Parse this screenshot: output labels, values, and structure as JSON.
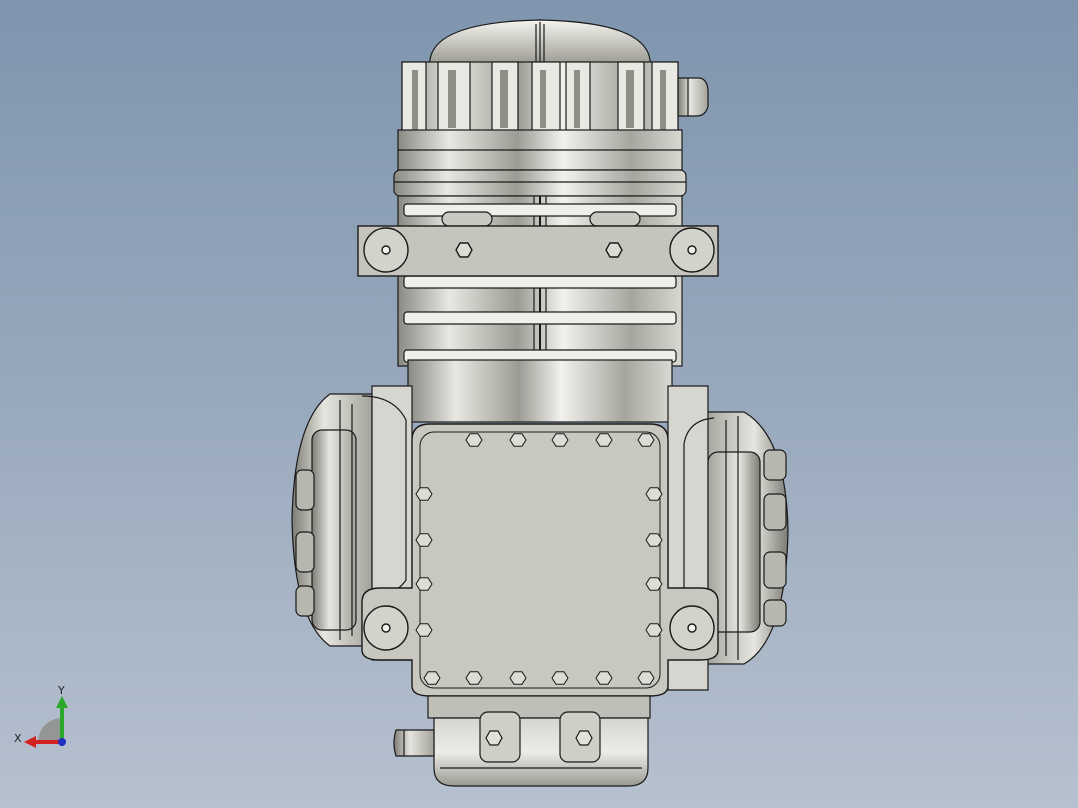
{
  "viewport": {
    "background_top": "#7f95ae",
    "background_bottom": "#b6c1cf"
  },
  "model": {
    "description_icon": "engine-assembly-icon",
    "metal_light": "#e4e3dd",
    "metal_mid": "#bdbcb4",
    "metal_dark": "#6e6d66",
    "cover_plate": "#c9c8c0",
    "edge_color": "#1a1a1a"
  },
  "triad": {
    "x_label": "X",
    "y_label": "Y",
    "x_color": "#d42020",
    "y_color": "#2aa82a",
    "z_color": "#2030c0"
  }
}
